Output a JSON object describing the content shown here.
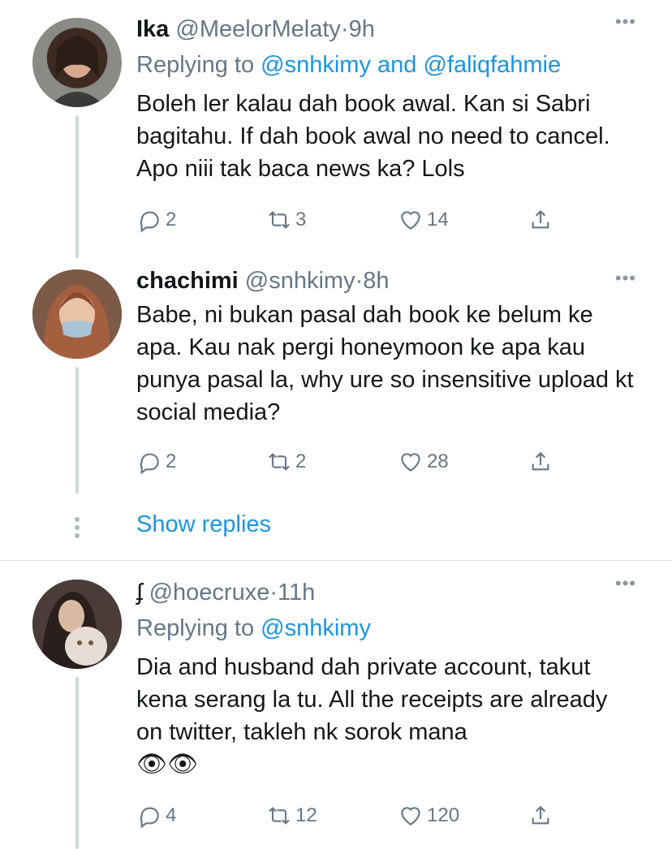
{
  "tweets": [
    {
      "name": "Ika",
      "handle": "@MeelorMelaty",
      "dot": "·",
      "time": "9h",
      "replying_prefix": "Replying to ",
      "replying_mentions": "@snhkimy and @faliqfahmie",
      "body": "Boleh ler kalau dah book awal. Kan si Sabri bagitahu. If dah book awal no need to cancel. Apo niii tak baca news ka? Lols",
      "replies": "2",
      "retweets": "3",
      "likes": "14",
      "more": "•••"
    },
    {
      "name": "chachimi",
      "handle": "@snhkimy",
      "dot": "·",
      "time": "8h",
      "body": "Babe, ni bukan pasal dah book ke belum ke apa. Kau nak pergi honeymoon ke apa kau punya pasal la, why ure so insensitive upload kt social media?",
      "replies": "2",
      "retweets": "2",
      "likes": "28",
      "more": "•••"
    },
    {
      "name": "ʄ",
      "handle": "@hoecruxe",
      "dot": "·",
      "time": "11h",
      "replying_prefix": "Replying to ",
      "replying_mentions": "@snhkimy",
      "body": "Dia and husband dah private account, takut kena serang la tu. All the receipts are already on twitter, takleh nk sorok mana",
      "emoji": "👁👁",
      "replies": "4",
      "retweets": "12",
      "likes": "120",
      "more": "•••"
    }
  ],
  "show_replies": "Show replies",
  "icons": {
    "reply": "reply-icon",
    "retweet": "retweet-icon",
    "like": "like-icon",
    "share": "share-icon"
  },
  "colors": {
    "accent": "#1b95e0",
    "muted": "#657786",
    "thread_line": "#cfd9de"
  }
}
